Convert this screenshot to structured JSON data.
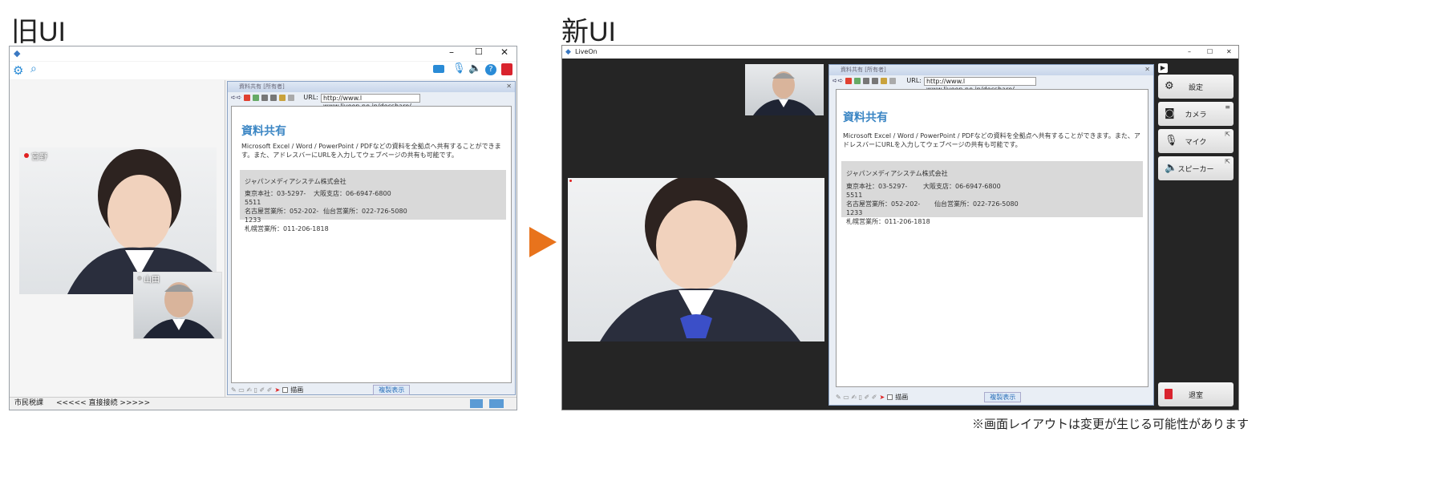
{
  "headings": {
    "old": "旧UI",
    "new": "新UI"
  },
  "old_ui": {
    "window_controls": {
      "min": "–",
      "max": "☐",
      "close": "✕"
    },
    "participants": [
      {
        "name": "宮野",
        "status_color": "#e02020"
      },
      {
        "name": "山田",
        "status_color": "#bbbbbb"
      }
    ],
    "status_bar": {
      "left": "市民税課",
      "middle": "<<<<< 直接接続 >>>>>"
    }
  },
  "doc_pane": {
    "title": "資料共有 [所有者]",
    "url_label": "URL:",
    "url": "http://www.l www.liveon.ne.jp/docshare/",
    "heading": "資料共有",
    "body": "Microsoft Excel / Word / PowerPoint / PDFなどの資料を全拠点へ共有することができます。また、アドレスバーにURLを入力してウェブページの共有も可能です。",
    "company": "ジャパンメディアシステム株式会社",
    "offices": [
      {
        "a": "東京本社：03-5297-5511",
        "b": "大阪支店：06-6947-6800"
      },
      {
        "a": "名古屋営業所：052-202-1233",
        "b": "仙台営業所：022-726-5080"
      },
      {
        "a": "札幌営業所：011-206-1818",
        "b": ""
      }
    ],
    "draw_label": "描画",
    "sync_label": "複製表示"
  },
  "new_ui": {
    "app_title": "LiveOn",
    "window_controls": {
      "min": "–",
      "max": "☐",
      "close": "✕"
    },
    "side_buttons": [
      {
        "label": "設定",
        "icon": "gear-icon"
      },
      {
        "label": "カメラ",
        "icon": "camera-icon"
      },
      {
        "label": "マイク",
        "icon": "mic-icon"
      },
      {
        "label": "スピーカー",
        "icon": "speaker-icon"
      }
    ],
    "leave_label": "退室"
  },
  "footnote": "※画面レイアウトは変更が生じる可能性があります",
  "colors": {
    "arrow": "#e8731c",
    "accent": "#3b86c4",
    "dark": "#252525"
  }
}
